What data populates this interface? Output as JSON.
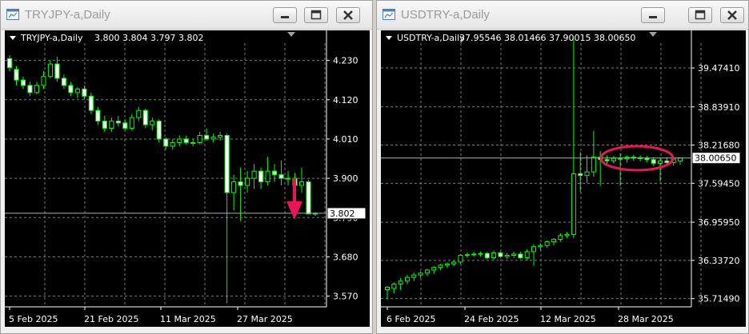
{
  "windows": [
    {
      "id": "left",
      "title": "TRYJPY-a,Daily",
      "header_symbol": "TRYJPY-a,Daily",
      "header_ohlc": "3.800 3.804 3.797 3.802",
      "current_price_label": "3.802",
      "chart_data": {
        "type": "candlestick",
        "y_ticks": [
          "4.230",
          "4.120",
          "4.010",
          "3.900",
          "3.790",
          "3.680",
          "3.570"
        ],
        "ylim": [
          3.54,
          4.265
        ],
        "x_ticks": [
          "5 Feb 2025",
          "21 Feb 2025",
          "11 Mar 2025",
          "27 Mar 2025"
        ],
        "grid": true,
        "bull_color": "#00ff00",
        "bear_color": "#ffffff",
        "current_price": 3.802,
        "annotation": "red-down-arrow",
        "candles": [
          [
            4.235,
            4.245,
            4.2,
            4.21
          ],
          [
            4.205,
            4.215,
            4.16,
            4.175
          ],
          [
            4.175,
            4.185,
            4.15,
            4.16
          ],
          [
            4.16,
            4.17,
            4.13,
            4.14
          ],
          [
            4.14,
            4.17,
            4.135,
            4.16
          ],
          [
            4.16,
            4.2,
            4.15,
            4.185
          ],
          [
            4.185,
            4.23,
            4.18,
            4.22
          ],
          [
            4.22,
            4.24,
            4.17,
            4.18
          ],
          [
            4.18,
            4.19,
            4.15,
            4.16
          ],
          [
            4.16,
            4.17,
            4.13,
            4.14
          ],
          [
            4.14,
            4.155,
            4.125,
            4.15
          ],
          [
            4.15,
            4.16,
            4.12,
            4.13
          ],
          [
            4.13,
            4.14,
            4.08,
            4.09
          ],
          [
            4.09,
            4.1,
            4.05,
            4.06
          ],
          [
            4.06,
            4.075,
            4.03,
            4.04
          ],
          [
            4.04,
            4.07,
            4.03,
            4.06
          ],
          [
            4.06,
            4.075,
            4.045,
            4.055
          ],
          [
            4.055,
            4.065,
            4.035,
            4.04
          ],
          [
            4.04,
            4.08,
            4.035,
            4.07
          ],
          [
            4.07,
            4.1,
            4.06,
            4.09
          ],
          [
            4.09,
            4.095,
            4.04,
            4.05
          ],
          [
            4.05,
            4.07,
            4.035,
            4.06
          ],
          [
            4.06,
            4.065,
            4.0,
            4.01
          ],
          [
            4.01,
            4.015,
            3.98,
            3.99
          ],
          [
            3.99,
            4.01,
            3.98,
            4.0
          ],
          [
            4.0,
            4.02,
            3.99,
            4.01
          ],
          [
            4.01,
            4.02,
            3.995,
            4.0
          ],
          [
            4.0,
            4.01,
            3.99,
            4.0
          ],
          [
            4.0,
            4.03,
            3.995,
            4.02
          ],
          [
            4.02,
            4.04,
            4.005,
            4.01
          ],
          [
            4.01,
            4.025,
            4.0,
            4.015
          ],
          [
            4.015,
            4.03,
            4.005,
            4.02
          ],
          [
            4.02,
            4.025,
            3.55,
            3.86
          ],
          [
            3.86,
            3.91,
            3.81,
            3.89
          ],
          [
            3.89,
            3.93,
            3.78,
            3.88
          ],
          [
            3.88,
            3.92,
            3.86,
            3.9
          ],
          [
            3.9,
            3.94,
            3.87,
            3.92
          ],
          [
            3.92,
            3.93,
            3.87,
            3.89
          ],
          [
            3.89,
            3.96,
            3.88,
            3.92
          ],
          [
            3.92,
            3.94,
            3.89,
            3.91
          ],
          [
            3.91,
            3.95,
            3.88,
            3.9
          ],
          [
            3.9,
            3.92,
            3.88,
            3.9
          ],
          [
            3.9,
            3.915,
            3.87,
            3.88
          ],
          [
            3.88,
            3.93,
            3.86,
            3.89
          ],
          [
            3.89,
            3.895,
            3.81,
            3.8
          ],
          [
            3.8,
            3.805,
            3.795,
            3.802
          ]
        ]
      }
    },
    {
      "id": "right",
      "title": "USDTRY-a,Daily",
      "header_symbol": "USDTRY-a,Daily",
      "header_ohlc": "37.95546 38.01466 37.90015 38.00650",
      "current_price_label": "38.00650",
      "chart_data": {
        "type": "candlestick",
        "y_ticks": [
          "39.47410",
          "38.83910",
          "38.21680",
          "37.59450",
          "36.95950",
          "36.33720",
          "35.71490"
        ],
        "ylim": [
          35.58,
          39.8
        ],
        "x_ticks": [
          "6 Feb 2025",
          "24 Feb 2025",
          "12 Mar 2025",
          "28 Mar 2025"
        ],
        "grid": true,
        "bull_color": "#00ff00",
        "bear_color": "#ffffff",
        "current_price": 38.0065,
        "annotation": "red-ellipse",
        "candles": [
          [
            35.86,
            35.92,
            35.7,
            35.9
          ],
          [
            35.88,
            35.98,
            35.8,
            35.95
          ],
          [
            35.95,
            36.05,
            35.85,
            36.0
          ],
          [
            36.0,
            36.1,
            35.95,
            36.06
          ],
          [
            36.06,
            36.14,
            36.0,
            36.1
          ],
          [
            36.1,
            36.16,
            36.05,
            36.13
          ],
          [
            36.13,
            36.2,
            36.08,
            36.18
          ],
          [
            36.18,
            36.24,
            36.12,
            36.22
          ],
          [
            36.22,
            36.28,
            36.18,
            36.26
          ],
          [
            36.26,
            36.3,
            36.22,
            36.28
          ],
          [
            36.28,
            36.34,
            36.24,
            36.31
          ],
          [
            36.31,
            36.44,
            36.28,
            36.42
          ],
          [
            36.42,
            36.46,
            36.38,
            36.43
          ],
          [
            36.43,
            36.47,
            36.4,
            36.44
          ],
          [
            36.44,
            36.48,
            36.4,
            36.45
          ],
          [
            36.45,
            36.47,
            36.36,
            36.38
          ],
          [
            36.38,
            36.5,
            36.34,
            36.46
          ],
          [
            36.46,
            36.48,
            36.38,
            36.4
          ],
          [
            36.4,
            36.46,
            36.36,
            36.42
          ],
          [
            36.42,
            36.48,
            36.38,
            36.44
          ],
          [
            36.44,
            36.48,
            36.36,
            36.38
          ],
          [
            36.38,
            36.52,
            36.34,
            36.48
          ],
          [
            36.48,
            36.6,
            36.25,
            36.56
          ],
          [
            36.56,
            36.62,
            36.5,
            36.58
          ],
          [
            36.58,
            36.66,
            36.54,
            36.64
          ],
          [
            36.64,
            36.7,
            36.58,
            36.68
          ],
          [
            36.68,
            36.78,
            36.64,
            36.74
          ],
          [
            36.74,
            36.8,
            36.7,
            36.76
          ],
          [
            36.76,
            39.95,
            36.7,
            37.75
          ],
          [
            37.75,
            38.1,
            37.45,
            37.72
          ],
          [
            37.72,
            38.05,
            37.6,
            37.78
          ],
          [
            37.78,
            38.45,
            37.7,
            38.02
          ],
          [
            38.02,
            38.12,
            37.55,
            37.98
          ],
          [
            37.98,
            38.05,
            37.9,
            37.96
          ],
          [
            37.96,
            38.04,
            37.92,
            38.0
          ],
          [
            38.0,
            38.08,
            37.55,
            37.99
          ],
          [
            37.99,
            38.05,
            37.93,
            38.02
          ],
          [
            38.02,
            38.06,
            37.96,
            38.01
          ],
          [
            38.01,
            38.05,
            37.95,
            38.0
          ],
          [
            38.0,
            38.04,
            37.94,
            37.98
          ],
          [
            37.98,
            38.02,
            37.88,
            37.92
          ],
          [
            37.92,
            38.0,
            37.62,
            37.96
          ],
          [
            37.96,
            38.02,
            37.9,
            37.93
          ],
          [
            37.93,
            38.04,
            37.88,
            37.99
          ],
          [
            37.955,
            38.015,
            37.9,
            38.007
          ]
        ]
      }
    }
  ],
  "controls": {
    "minimize_icon": "minimize-icon",
    "maximize_icon": "maximize-icon",
    "close_icon": "close-icon",
    "dropdown_icon": "dropdown-triangle-icon"
  }
}
